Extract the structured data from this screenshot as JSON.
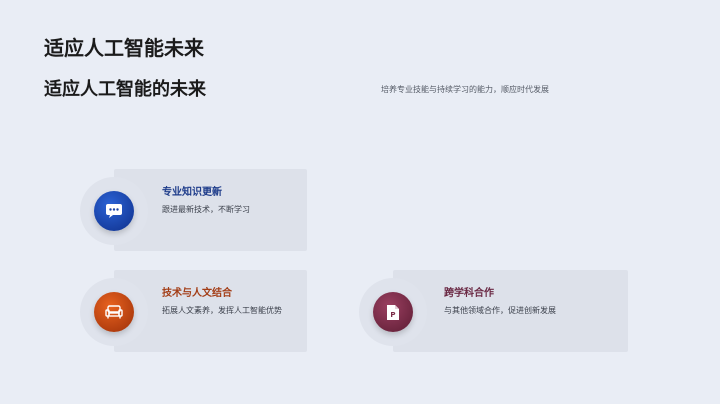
{
  "slide": {
    "title": "适应人工智能未来",
    "subtitle": "适应人工智能的未来",
    "description": "培养专业技能与持续学习的能力，顺应时代发展"
  },
  "cards": [
    {
      "title": "专业知识更新",
      "text": "跟进最新技术，不断学习",
      "icon": "chat-icon",
      "color": "#1a43a8",
      "title_color": "#1d3b8a"
    },
    {
      "title": "技术与人文结合",
      "text": "拓展人文素养，发挥人工智能优势",
      "icon": "sofa-icon",
      "color": "#c4410f",
      "title_color": "#a33d16"
    },
    {
      "title": "跨学科合作",
      "text": "与其他领域合作，促进创新发展",
      "icon": "document-icon",
      "color": "#7a2a46",
      "title_color": "#6b2a45"
    }
  ]
}
